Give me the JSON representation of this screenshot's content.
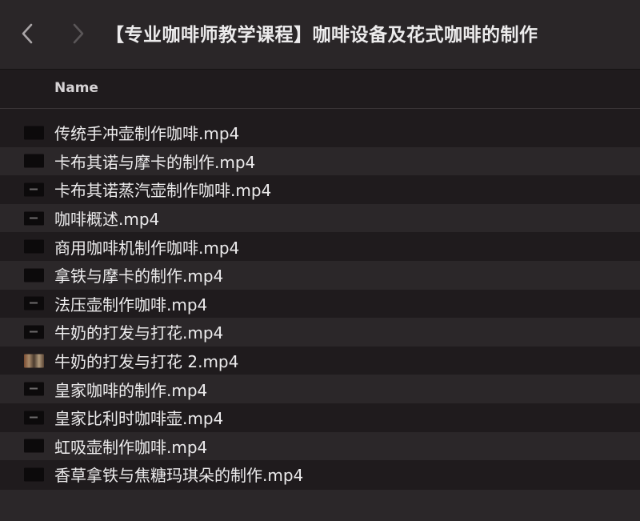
{
  "toolbar": {
    "title": "【专业咖啡师教学课程】咖啡设备及花式咖啡的制作"
  },
  "columns": {
    "name": "Name"
  },
  "files": [
    {
      "name": "传统手冲壶制作咖啡.mp4",
      "thumbnail": "dark"
    },
    {
      "name": "卡布其诺与摩卡的制作.mp4",
      "thumbnail": "dark"
    },
    {
      "name": "卡布其诺蒸汽壶制作咖啡.mp4",
      "thumbnail": "dash"
    },
    {
      "name": "咖啡概述.mp4",
      "thumbnail": "dash"
    },
    {
      "name": "商用咖啡机制作咖啡.mp4",
      "thumbnail": "dark"
    },
    {
      "name": "拿铁与摩卡的制作.mp4",
      "thumbnail": "dark"
    },
    {
      "name": "法压壶制作咖啡.mp4",
      "thumbnail": "dash"
    },
    {
      "name": "牛奶的打发与打花.mp4",
      "thumbnail": "dash"
    },
    {
      "name": "牛奶的打发与打花 2.mp4",
      "thumbnail": "colorful"
    },
    {
      "name": "皇家咖啡的制作.mp4",
      "thumbnail": "dash"
    },
    {
      "name": "皇家比利时咖啡壶.mp4",
      "thumbnail": "dash"
    },
    {
      "name": "虹吸壶制作咖啡.mp4",
      "thumbnail": "dark"
    },
    {
      "name": "香草拿铁与焦糖玛琪朵的制作.mp4",
      "thumbnail": "dark"
    }
  ],
  "icons": {
    "back": "chevron-left-icon",
    "forward": "chevron-right-icon",
    "file_thumbnail": "video-thumbnail-icon"
  },
  "colors": {
    "background": "#1f1b1d",
    "toolbar": "#2a2628",
    "alt_row": "#2b2729",
    "text": "#ecebec"
  }
}
